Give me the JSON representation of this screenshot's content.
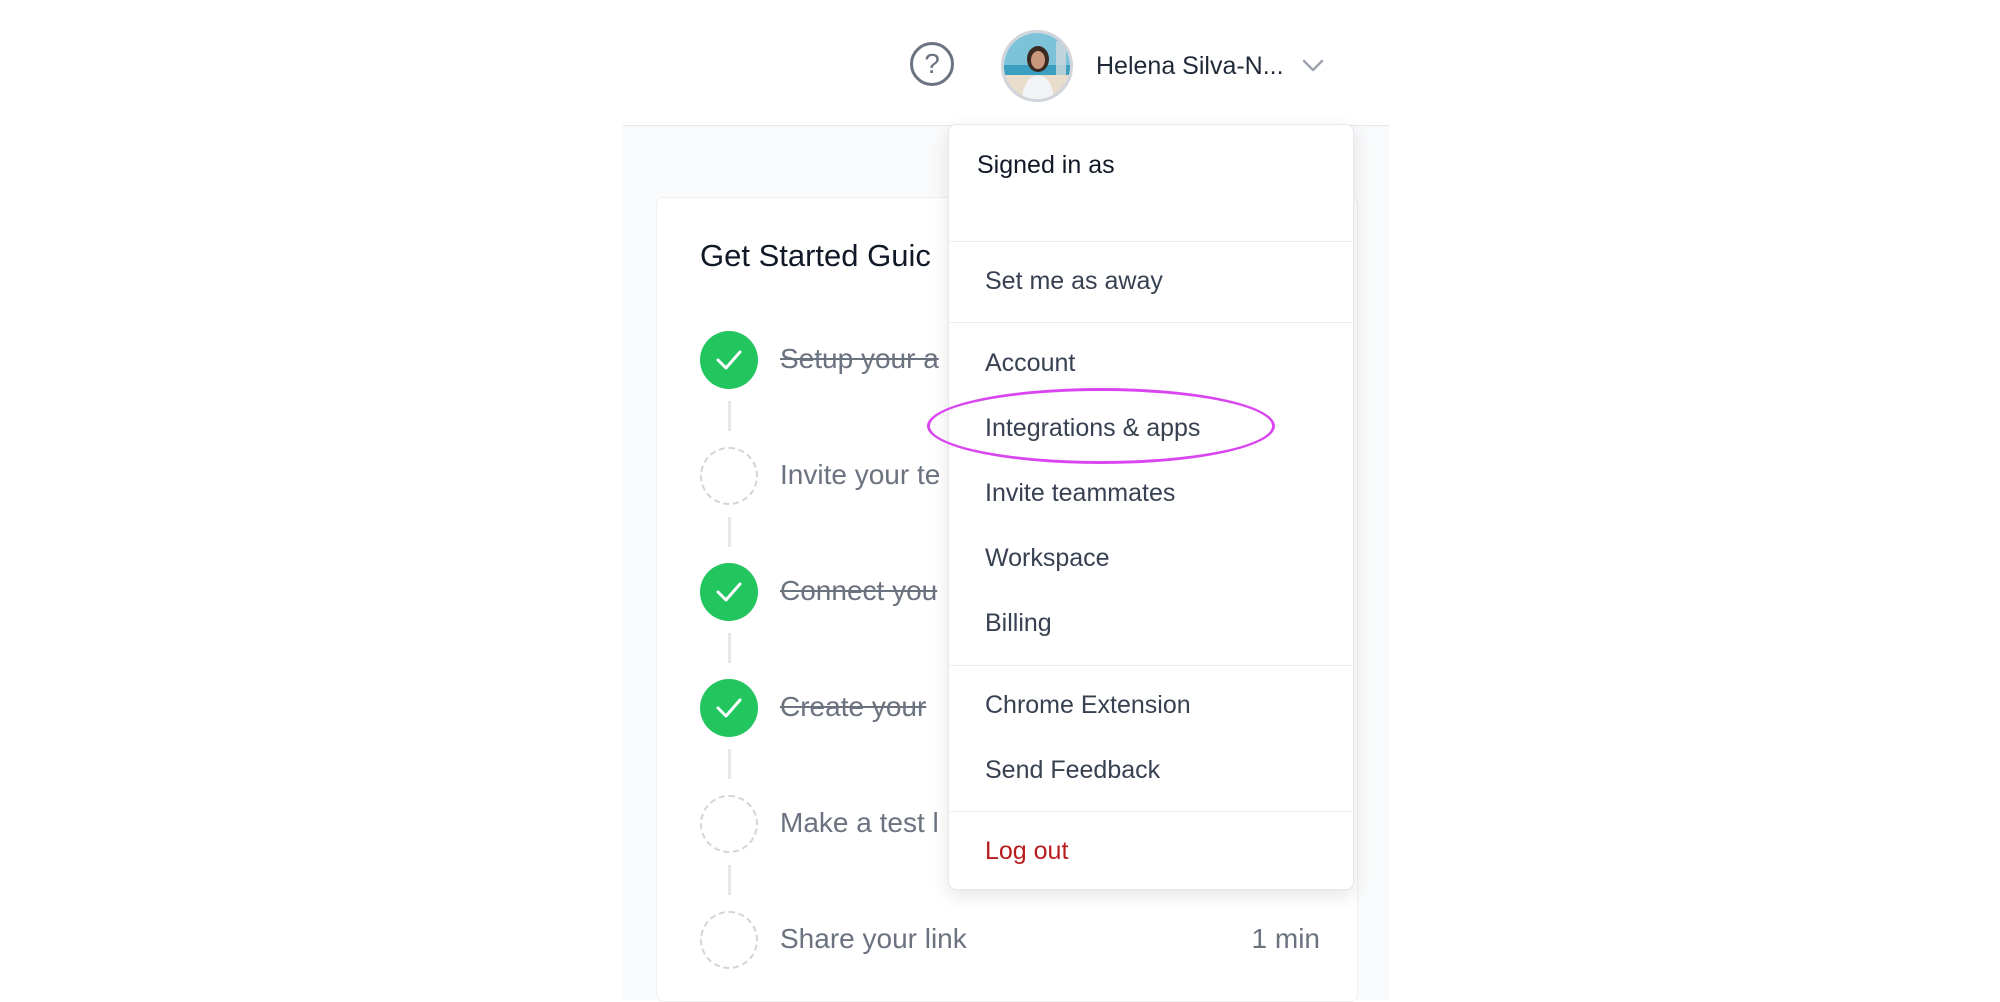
{
  "header": {
    "help_glyph": "?",
    "user_name": "Helena Silva-N...",
    "help_icon": "question-circle-icon",
    "chevron_icon": "chevron-down-icon"
  },
  "guide": {
    "title": "Get Started Guic",
    "steps": [
      {
        "label": "Setup your a",
        "status": "done"
      },
      {
        "label": "Invite your te",
        "status": "todo"
      },
      {
        "label": "Connect you",
        "status": "done"
      },
      {
        "label": "Create your",
        "status": "done"
      },
      {
        "label": "Make a test l",
        "status": "todo"
      },
      {
        "label": "Share your link",
        "status": "todo",
        "time": "1 min"
      }
    ]
  },
  "menu": {
    "signed_in_label": "Signed in as",
    "items": [
      {
        "label": "Set me as away"
      },
      {
        "label": "Account"
      },
      {
        "label": "Integrations & apps",
        "highlighted": true
      },
      {
        "label": "Invite teammates"
      },
      {
        "label": "Workspace"
      },
      {
        "label": "Billing"
      },
      {
        "label": "Chrome Extension"
      },
      {
        "label": "Send Feedback"
      },
      {
        "label": "Log out"
      }
    ]
  },
  "colors": {
    "success": "#22c55e",
    "danger": "#b91c1c",
    "highlight": "#d946ef"
  }
}
